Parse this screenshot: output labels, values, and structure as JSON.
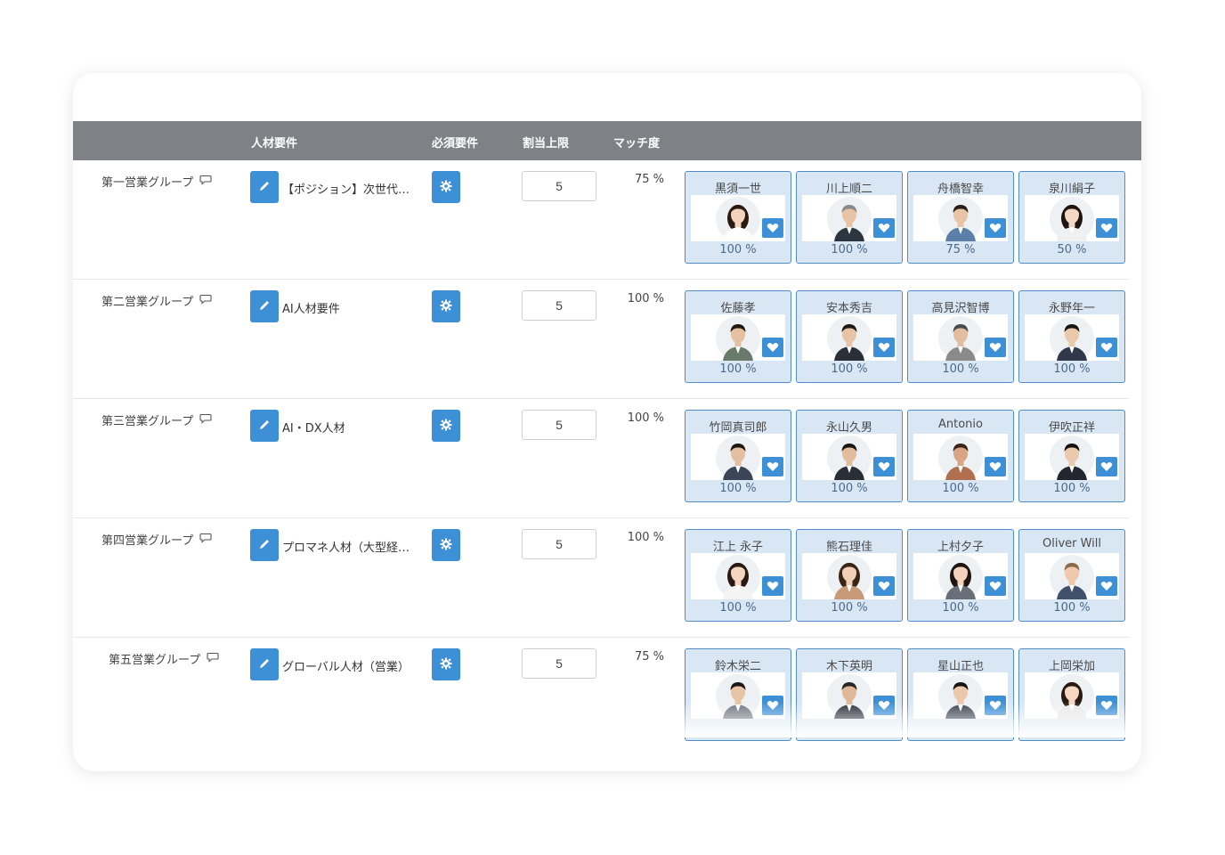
{
  "header": {
    "requirement": "人材要件",
    "mandatory": "必須要件",
    "limit": "割当上限",
    "match": "マッチ度"
  },
  "colors": {
    "accent": "#3d8fd6",
    "header_bg": "#7e8186",
    "card_bg": "#d9e7f5"
  },
  "rows": [
    {
      "group": "第一営業グループ",
      "requirement": "【ポジション】次世代…",
      "limit": "5",
      "match": "75 %",
      "candidates": [
        {
          "name": "黒須一世",
          "score": "100 %",
          "gender": "f",
          "shirt": "#ffffff",
          "hair": "#2a1a12",
          "skin": "#f3d3bd"
        },
        {
          "name": "川上順二",
          "score": "100 %",
          "gender": "m",
          "shirt": "#2d3540",
          "hair": "#8a8a8a",
          "skin": "#e8c3a4"
        },
        {
          "name": "舟橋智幸",
          "score": "75 %",
          "gender": "m",
          "shirt": "#5b7fa8",
          "hair": "#2a2018",
          "skin": "#e9c4a5"
        },
        {
          "name": "泉川絹子",
          "score": "50 %",
          "gender": "f",
          "shirt": "#f0f0f0",
          "hair": "#1e1410",
          "skin": "#f4d8c4"
        }
      ]
    },
    {
      "group": "第二営業グループ",
      "requirement": "AI人材要件",
      "limit": "5",
      "match": "100 %",
      "candidates": [
        {
          "name": "佐藤孝",
          "score": "100 %",
          "gender": "m",
          "shirt": "#6a7a6a",
          "hair": "#201810",
          "skin": "#e5bf9f"
        },
        {
          "name": "安本秀吉",
          "score": "100 %",
          "gender": "m",
          "shirt": "#2b2f38",
          "hair": "#1e1a16",
          "skin": "#e8c4a6"
        },
        {
          "name": "高見沢智博",
          "score": "100 %",
          "gender": "m",
          "shirt": "#8a8a8a",
          "hair": "#4a4a4a",
          "skin": "#e2bda0"
        },
        {
          "name": "永野年一",
          "score": "100 %",
          "gender": "m",
          "shirt": "#30384a",
          "hair": "#181410",
          "skin": "#eac8ab"
        }
      ]
    },
    {
      "group": "第三営業グループ",
      "requirement": "AI・DX人材",
      "limit": "5",
      "match": "100 %",
      "candidates": [
        {
          "name": "竹岡真司郎",
          "score": "100 %",
          "gender": "m",
          "shirt": "#3a4658",
          "hair": "#1c1814",
          "skin": "#e4bea0"
        },
        {
          "name": "永山久男",
          "score": "100 %",
          "gender": "m",
          "shirt": "#2a2e36",
          "hair": "#1a1612",
          "skin": "#e3bc9c"
        },
        {
          "name": "Antonio",
          "score": "100 %",
          "gender": "m",
          "shirt": "#b07050",
          "hair": "#3a2418",
          "skin": "#d9a582"
        },
        {
          "name": "伊吹正祥",
          "score": "100 %",
          "gender": "m",
          "shirt": "#23262e",
          "hair": "#161210",
          "skin": "#ebc9ad"
        }
      ]
    },
    {
      "group": "第四営業グループ",
      "requirement": "プロマネ人材（大型経…",
      "limit": "5",
      "match": "100 %",
      "candidates": [
        {
          "name": "江上 永子",
          "score": "100 %",
          "gender": "f",
          "shirt": "#f4f4f4",
          "hair": "#2a1a12",
          "skin": "#f3d5c0"
        },
        {
          "name": "熊石理佳",
          "score": "100 %",
          "gender": "f",
          "shirt": "#c89a78",
          "hair": "#3a2418",
          "skin": "#f0cfb6"
        },
        {
          "name": "上村夕子",
          "score": "100 %",
          "gender": "f",
          "shirt": "#6a6e78",
          "hair": "#1e1410",
          "skin": "#f2d2bb"
        },
        {
          "name": "Oliver Will",
          "score": "100 %",
          "gender": "m",
          "shirt": "#40506a",
          "hair": "#8a6a4a",
          "skin": "#efc9ad"
        }
      ]
    },
    {
      "group": "第五営業グループ",
      "requirement": "グローバル人材（営業）",
      "limit": "5",
      "match": "75 %",
      "candidates": [
        {
          "name": "鈴木栄二",
          "score": "",
          "gender": "m",
          "shirt": "#6e7480",
          "hair": "#1c1814",
          "skin": "#e8c4a6"
        },
        {
          "name": "木下英明",
          "score": "",
          "gender": "m",
          "shirt": "#2a2e36",
          "hair": "#2a2622",
          "skin": "#e0b898"
        },
        {
          "name": "星山正也",
          "score": "",
          "gender": "m",
          "shirt": "#3a4050",
          "hair": "#181410",
          "skin": "#ebc8aa"
        },
        {
          "name": "上岡栄加",
          "score": "",
          "gender": "f",
          "shirt": "#e8e8e8",
          "hair": "#2a1a12",
          "skin": "#f4d8c4"
        }
      ]
    }
  ]
}
